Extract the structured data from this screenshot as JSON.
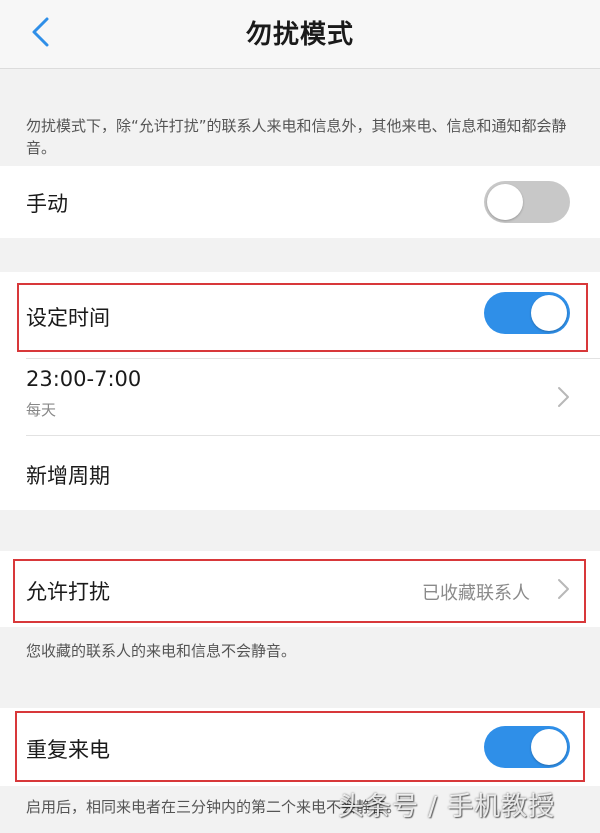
{
  "header": {
    "title": "勿扰模式",
    "back_icon": "chevron-left-icon",
    "accent": "#2f8fe8"
  },
  "intro_note": "勿扰模式下，除“允许打扰”的联系人来电和信息外，其他来电、信息和通知都会静音。",
  "manual": {
    "label": "手动",
    "enabled": false
  },
  "schedule": {
    "label": "设定时间",
    "enabled": true,
    "time_range": "23:00-7:00",
    "repeat": "每天",
    "add_period_label": "新增周期"
  },
  "allow_interrupt": {
    "label": "允许打扰",
    "value": "已收藏联系人",
    "note": "您收藏的联系人的来电和信息不会静音。"
  },
  "repeat_call": {
    "label": "重复来电",
    "enabled": true,
    "note": "启用后，相同来电者在三分钟内的第二个来电不会静音。"
  },
  "watermark": "头条号 / 手机教授",
  "colors": {
    "highlight_box": "#d8383a",
    "toggle_on": "#2f8fe8",
    "toggle_off": "#c8c8c8"
  }
}
